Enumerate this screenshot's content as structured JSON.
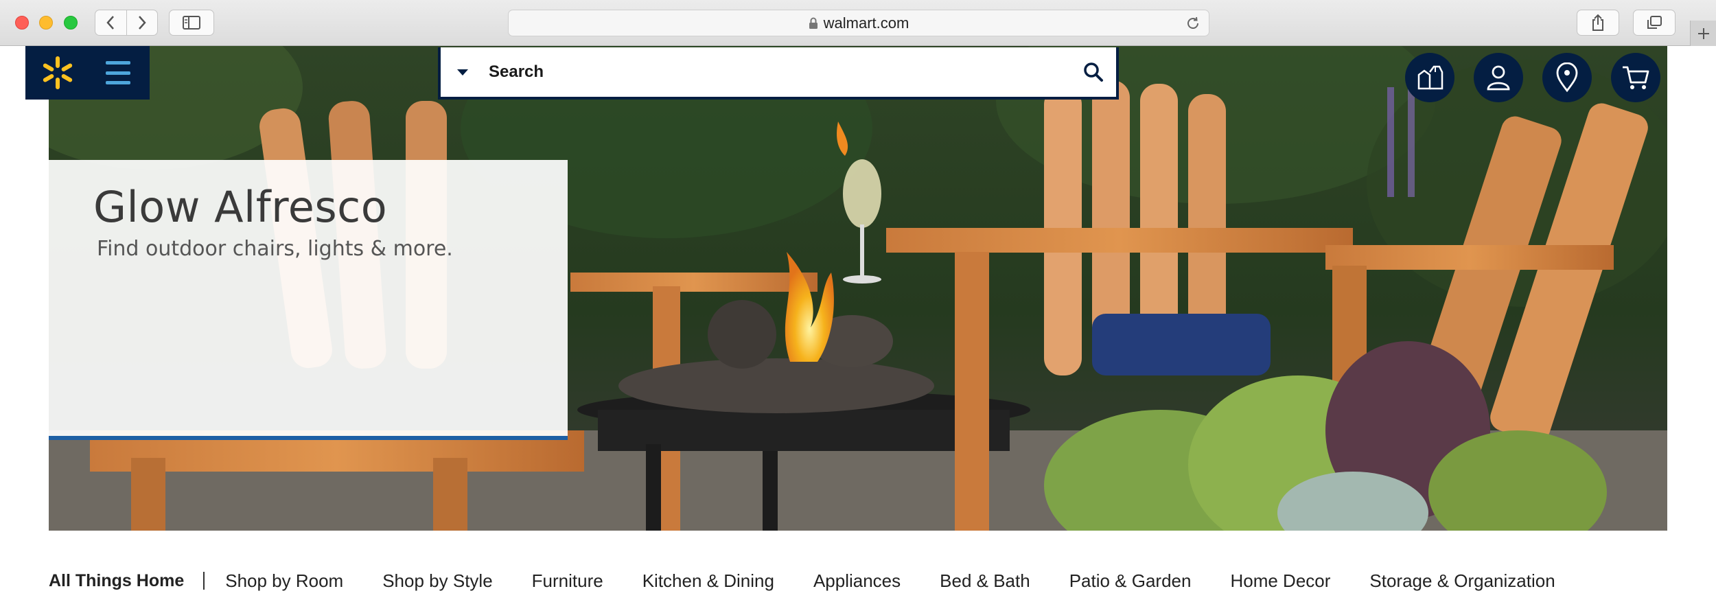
{
  "browser": {
    "url": "walmart.com"
  },
  "header": {
    "search_placeholder": "Search"
  },
  "hero": {
    "title": "Glow Alfresco",
    "subtitle": "Find outdoor chairs, lights & more."
  },
  "category_nav": {
    "title": "All Things Home",
    "items": [
      {
        "label": "Shop by Room"
      },
      {
        "label": "Shop by Style"
      },
      {
        "label": "Furniture"
      },
      {
        "label": "Kitchen & Dining"
      },
      {
        "label": "Appliances"
      },
      {
        "label": "Bed & Bath"
      },
      {
        "label": "Patio & Garden"
      },
      {
        "label": "Home Decor"
      },
      {
        "label": "Storage & Organization"
      }
    ]
  },
  "colors": {
    "brand_navy": "#041e42",
    "spark_yellow": "#ffc220",
    "menu_blue": "#4ea6dc",
    "promo_border": "#1f5fa4"
  },
  "icons": {
    "header_buttons": [
      "grocery-icon",
      "account-icon",
      "store-location-icon",
      "cart-icon"
    ]
  }
}
